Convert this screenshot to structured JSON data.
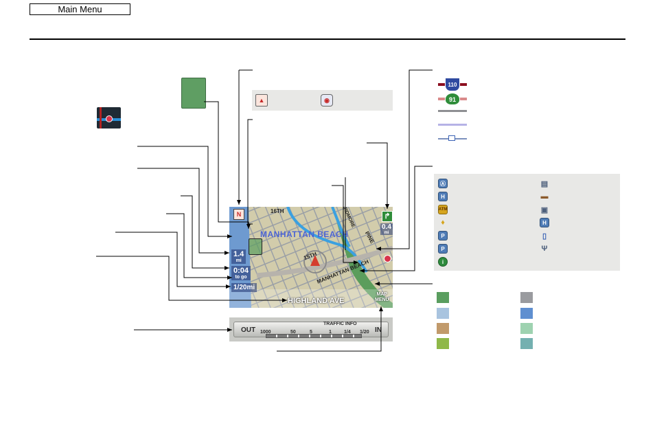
{
  "header": {
    "main_menu_label": "Main Menu"
  },
  "map": {
    "street_top": "16TH",
    "area_label": "MANHATTAN BEACH",
    "street_center": "15TH",
    "street_diag": "MANHATTAN BEACH",
    "street_right": "PINE",
    "street_far_right": "ARDMORE",
    "distance_left_value": "1.4",
    "distance_left_unit": "mi",
    "time_value": "0:04",
    "time_unit": "to go",
    "scale_value": "1/20mi",
    "current_street": "HIGHLAND AVE",
    "turn_distance_value": "0.4",
    "turn_distance_unit": "mi",
    "map_menu_line1": "MAP",
    "map_menu_line2": "MENU"
  },
  "scale_bar": {
    "out_label": "OUT",
    "in_label": "IN",
    "traffic_label": "TRAFFIC INFO",
    "marks": [
      "1000",
      "50",
      "5",
      "1",
      "1/4",
      "1/20"
    ]
  },
  "legend": {
    "interstate_shield": "110",
    "state_shield": "91",
    "line_colors": [
      "#8c0f20",
      "#72b37a",
      "#8e8f93",
      "#b6b2e6",
      "#7b90bd"
    ],
    "poi_icons": [
      {
        "icon": "acura-dealer-icon",
        "glyph": "Ⓐ"
      },
      {
        "icon": "honda-dealer-icon",
        "glyph": "H"
      },
      {
        "icon": "atm-icon",
        "glyph": "ATM"
      },
      {
        "icon": "bottle-icon",
        "glyph": "♦"
      },
      {
        "icon": "parking-icon",
        "glyph": "P"
      },
      {
        "icon": "parking-garage-icon",
        "glyph": "P"
      },
      {
        "icon": "info-icon",
        "glyph": "i"
      },
      {
        "icon": "shopping-icon",
        "glyph": "▤"
      },
      {
        "icon": "lodging-icon",
        "glyph": "▬"
      },
      {
        "icon": "gas-station-icon",
        "glyph": "▣"
      },
      {
        "icon": "hospital-icon",
        "glyph": "H"
      },
      {
        "icon": "train-icon",
        "glyph": "▯"
      },
      {
        "icon": "restaurant-icon",
        "glyph": "Ψ"
      }
    ],
    "area_colors": [
      "#5a9e5f",
      "#a9c4df",
      "#c19a6b",
      "#8fb849",
      "#9a9b9f",
      "#5f8fd0",
      "#9ed2b0",
      "#74b0b0"
    ]
  }
}
